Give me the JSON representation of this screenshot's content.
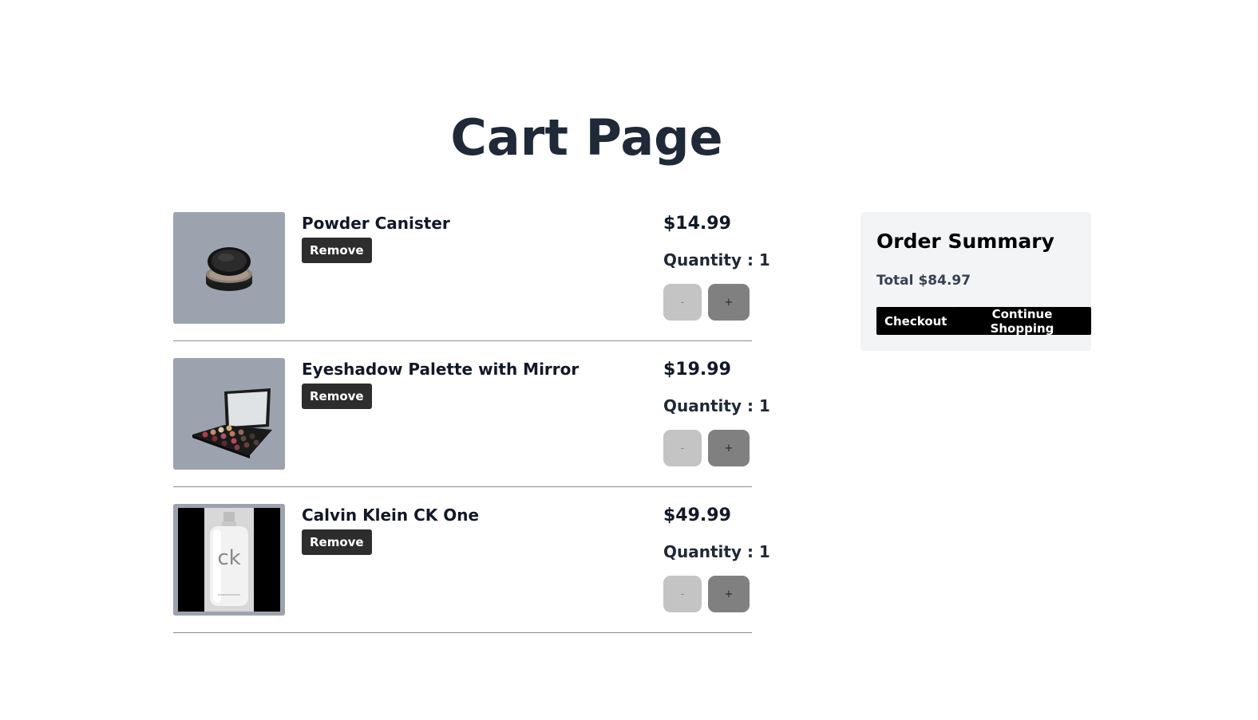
{
  "header": {
    "title": "Cart Page"
  },
  "cart": {
    "items": [
      {
        "name": "Powder Canister",
        "remove_label": "Remove",
        "price": "$14.99",
        "quantity_text": "Quantity : 1",
        "minus_label": "-",
        "plus_label": "+",
        "image_icon": "powder-compact-image"
      },
      {
        "name": "Eyeshadow Palette with Mirror",
        "remove_label": "Remove",
        "price": "$19.99",
        "quantity_text": "Quantity : 1",
        "minus_label": "-",
        "plus_label": "+",
        "image_icon": "eyeshadow-palette-image"
      },
      {
        "name": "Calvin Klein CK One",
        "remove_label": "Remove",
        "price": "$49.99",
        "quantity_text": "Quantity : 1",
        "minus_label": "-",
        "plus_label": "+",
        "image_icon": "perfume-bottle-image"
      }
    ]
  },
  "summary": {
    "title": "Order Summary",
    "total_label": "Total",
    "total_value": "$84.97",
    "checkout_label": "Checkout",
    "continue_label": "Continue Shopping"
  },
  "colors": {
    "title": "#1f2937",
    "thumb_bg": "#9ca3af",
    "remove_btn": "#2d2d2d",
    "summary_bg": "#f3f4f6",
    "action_btn": "#000000"
  }
}
